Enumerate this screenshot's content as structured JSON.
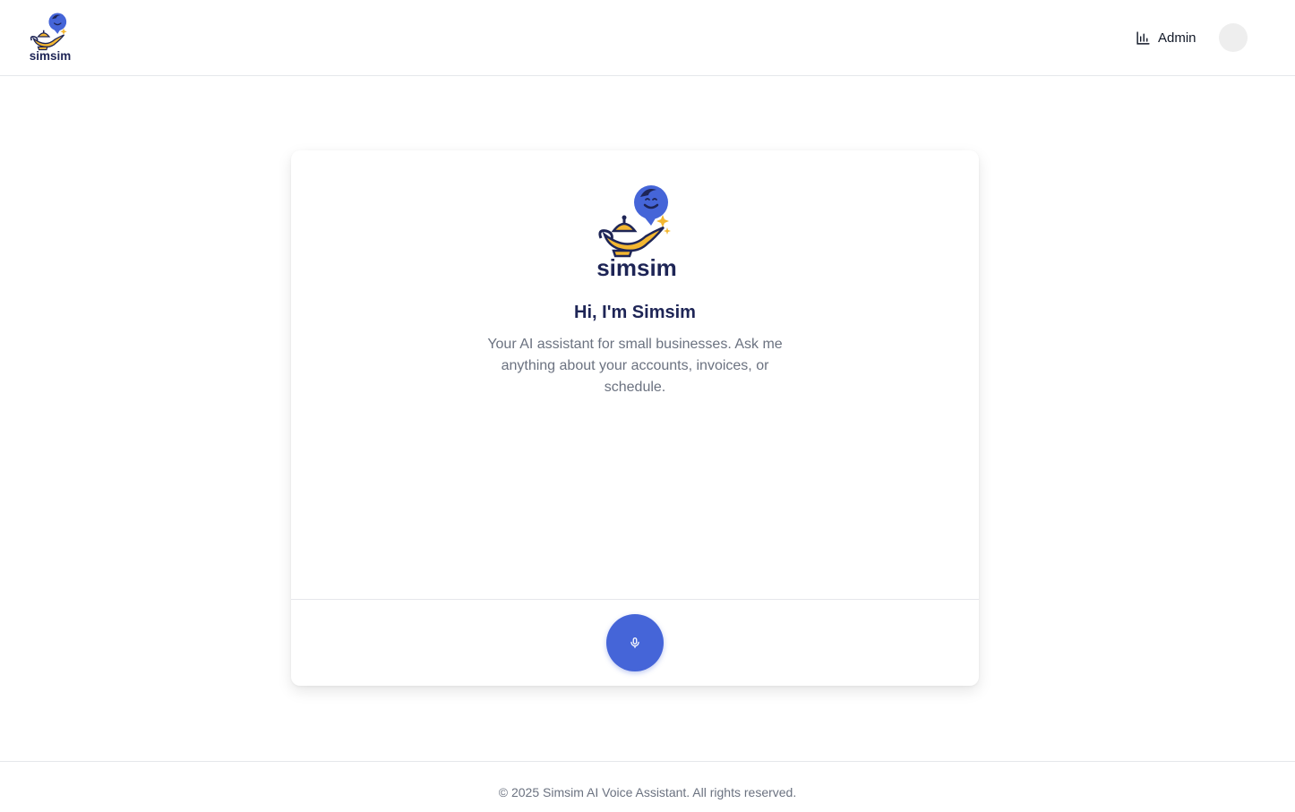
{
  "header": {
    "logo_text": "simsim",
    "admin_label": "Admin"
  },
  "card": {
    "logo_text": "simsim",
    "title": "Hi, I'm Simsim",
    "subtitle": "Your AI assistant for small businesses. Ask me anything about your accounts, invoices, or schedule."
  },
  "footer": {
    "text": "© 2025 Simsim AI Voice Assistant. All rights reserved."
  },
  "colors": {
    "brand_blue": "#4565d8",
    "lamp_gold": "#f3b731",
    "navy_text": "#1e2556"
  },
  "icons": {
    "admin": "bar-chart-icon",
    "mic": "microphone-icon"
  }
}
